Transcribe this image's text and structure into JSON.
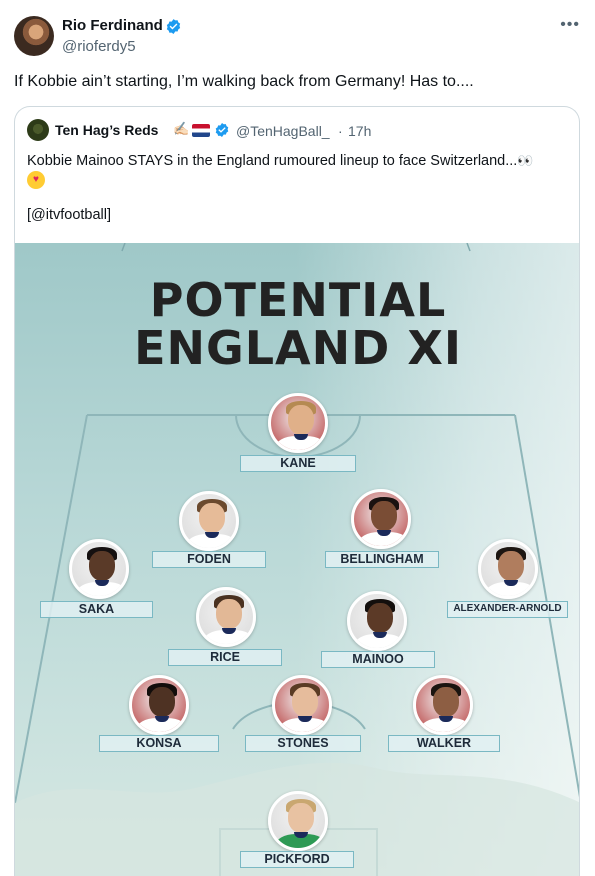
{
  "tweet": {
    "author_name": "Rio Ferdinand",
    "author_handle": "@rioferdy5",
    "text": "If Kobbie ain’t starting, I’m walking back from Germany! Has to....",
    "more_icon": "more-icon"
  },
  "quoted_tweet": {
    "author_name": "Ten Hag’s Reds",
    "author_handle": "@TenHagBall_",
    "separator": "·",
    "time": "17h",
    "emoji": "✍🏻",
    "text": "Kobbie Mainoo STAYS in the England rumoured lineup to face Switzerland...",
    "eyes_emoji": "👀",
    "source": "[@itvfootball]"
  },
  "graphic": {
    "title_line1": "POTENTIAL",
    "title_line2": "ENGLAND XI",
    "players": [
      {
        "name": "KANE",
        "skin": "#e0b089",
        "hair": "#b58a52",
        "bg": "#b53a3a"
      },
      {
        "name": "FODEN",
        "skin": "#e6bb98",
        "hair": "#6b4a2e",
        "bg": "#d9d9d9"
      },
      {
        "name": "BELLINGHAM",
        "skin": "#7a4d35",
        "hair": "#1a1210",
        "bg": "#b53a3a"
      },
      {
        "name": "SAKA",
        "skin": "#5a3a28",
        "hair": "#151010",
        "bg": "#d9d9d9"
      },
      {
        "name": "ALEXANDER-ARNOLD",
        "skin": "#b07d5e",
        "hair": "#1e1612",
        "bg": "#d9d9d9"
      },
      {
        "name": "RICE",
        "skin": "#e2b896",
        "hair": "#4a3120",
        "bg": "#d9d9d9"
      },
      {
        "name": "MAINOO",
        "skin": "#5c3a27",
        "hair": "#140f0d",
        "bg": "#d9d9d9"
      },
      {
        "name": "KONSA",
        "skin": "#4e3223",
        "hair": "#120d0b",
        "bg": "#b53a3a"
      },
      {
        "name": "STONES",
        "skin": "#e6bc9c",
        "hair": "#5a3b24",
        "bg": "#b53a3a"
      },
      {
        "name": "WALKER",
        "skin": "#8d5e43",
        "hair": "#1b1410",
        "bg": "#b53a3a"
      },
      {
        "name": "PICKFORD",
        "skin": "#e8c2a2",
        "hair": "#c9a770",
        "bg": "#d9d9d9"
      }
    ]
  },
  "colors": {
    "verified_blue": "#1d9bf0",
    "muted_text": "#536471",
    "label_border": "#7ab8c3",
    "keeper_shirt": "#2e9a55"
  }
}
